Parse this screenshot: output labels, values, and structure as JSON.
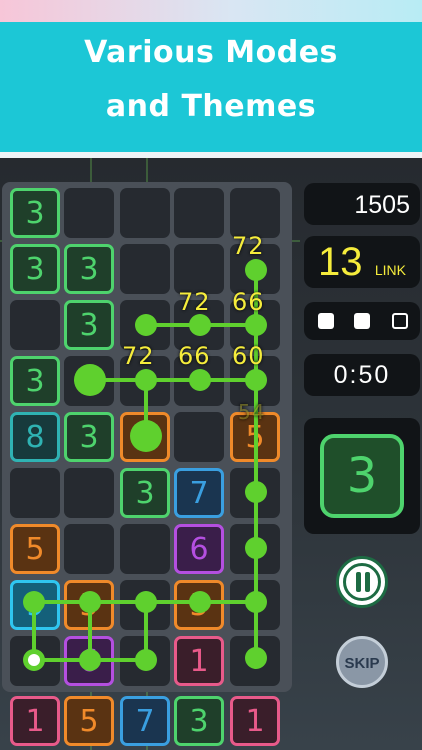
{
  "banner": {
    "line1": "Various Modes",
    "line2": "and Themes"
  },
  "colors": {
    "banner": "#1cc7d6",
    "chain": "#5fd02e",
    "chain_text": "#f5ec3c"
  },
  "hud": {
    "score": "1505",
    "link_count": "13",
    "link_label": "LINK",
    "lives": [
      "filled",
      "filled",
      "empty"
    ],
    "timer": "0:50",
    "next_tile": "3",
    "pause_icon": "pause-icon",
    "skip_label": "SKIP"
  },
  "board": {
    "rows": [
      [
        "3",
        "",
        "",
        "",
        ""
      ],
      [
        "3",
        "3",
        "",
        "",
        ""
      ],
      [
        "",
        "3",
        "",
        "",
        ""
      ],
      [
        "3",
        "",
        "",
        "",
        ""
      ],
      [
        "8",
        "3",
        "5",
        "",
        "5"
      ],
      [
        "",
        "",
        "3",
        "7",
        ""
      ],
      [
        "5",
        "",
        "",
        "6",
        ""
      ],
      [
        "9",
        "5",
        "",
        "5",
        ""
      ],
      [
        "",
        "6",
        "",
        "1",
        ""
      ]
    ],
    "bottom_row": [
      "1",
      "5",
      "7",
      "3",
      "1"
    ],
    "chain_labels": [
      "72",
      "72",
      "66",
      "72",
      "66",
      "60"
    ],
    "faded_label": "54"
  }
}
